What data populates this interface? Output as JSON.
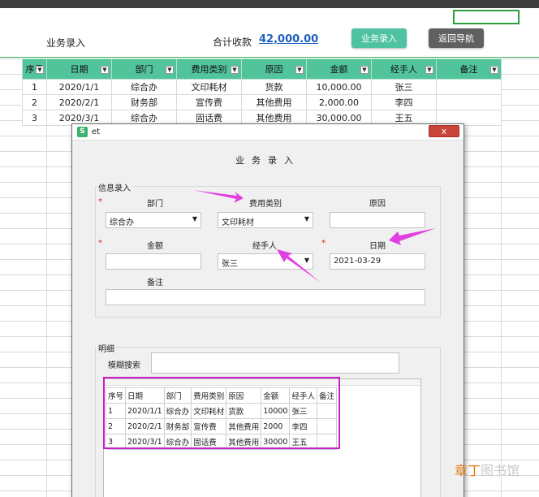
{
  "sheet": {
    "title_label": "业务录入",
    "total_label": "合计收款",
    "total_value": "42,000.00",
    "entry_button": "业务录入",
    "back_button": "返回导航",
    "columns": [
      "序号",
      "日期",
      "部门",
      "费用类别",
      "原因",
      "金额",
      "经手人",
      "备注"
    ],
    "rows": [
      [
        "1",
        "2020/1/1",
        "综合办",
        "文印耗材",
        "货款",
        "10,000.00",
        "张三",
        ""
      ],
      [
        "2",
        "2020/2/1",
        "财务部",
        "宣传费",
        "其他费用",
        "2,000.00",
        "李四",
        ""
      ],
      [
        "3",
        "2020/3/1",
        "综合办",
        "固话费",
        "其他费用",
        "30,000.00",
        "王五",
        ""
      ]
    ]
  },
  "dialog": {
    "logo": "S",
    "window_title": "et",
    "close_label": "x",
    "heading": "业务录入",
    "info_group": "信息录入",
    "dept_label": "部门",
    "dept_value": "综合办",
    "category_label": "费用类别",
    "category_value": "文印耗材",
    "reason_label": "原因",
    "reason_value": "",
    "amount_label": "金额",
    "amount_value": "",
    "handler_label": "经手人",
    "handler_value": "张三",
    "date_label": "日期",
    "date_value": "2021-03-29",
    "note_label": "备注",
    "note_value": "",
    "required_mark": "*",
    "detail_group": "明细",
    "search_label": "模糊搜索",
    "search_value": "",
    "detail_columns": [
      "序号",
      "日期",
      "部门",
      "费用类别",
      "原因",
      "金额",
      "经手人",
      "备注"
    ],
    "detail_rows": [
      [
        "1",
        "2020/1/1",
        "综合办",
        "文印耗材",
        "货款",
        "10000",
        "张三",
        ""
      ],
      [
        "2",
        "2020/2/1",
        "财务部",
        "宣传费",
        "其他费用",
        "2000",
        "李四",
        ""
      ],
      [
        "3",
        "2020/3/1",
        "综合办",
        "固话费",
        "其他费用",
        "30000",
        "王五",
        ""
      ]
    ]
  },
  "watermark": {
    "part1": "章丁",
    "part2": "图书馆"
  },
  "colors": {
    "header_green": "#52c49c",
    "accent_blue": "#1f5fbf",
    "annotation_magenta": "#c81fc8"
  }
}
